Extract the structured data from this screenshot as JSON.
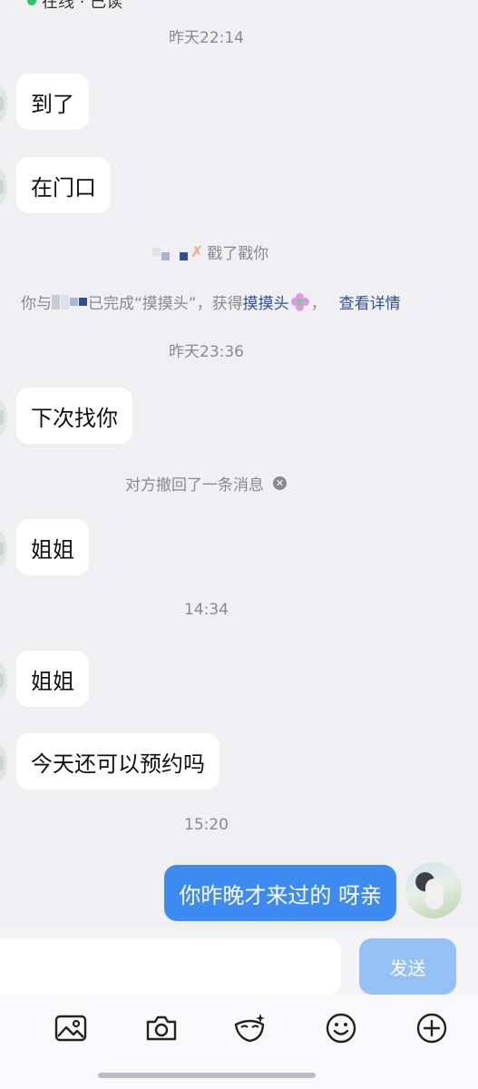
{
  "header": {
    "partial_text": "在线 · 已读"
  },
  "messages": {
    "time_1": "昨天22:14",
    "msg_1": "到了",
    "msg_2": "在门口",
    "poke_text": "戳了戳你",
    "achievement": {
      "prefix": "你与",
      "middle": "已完成“摸摸头”，获得",
      "award": "摸摸头",
      "suffix": "，",
      "link": "查看详情"
    },
    "time_2": "昨天23:36",
    "msg_3": "下次找你",
    "recall_text": "对方撤回了一条消息",
    "msg_4": "姐姐",
    "time_3": "14:34",
    "msg_5": "姐姐",
    "msg_6": "今天还可以预约吗",
    "time_4": "15:20",
    "my_msg": "你昨晚才来过的 呀亲"
  },
  "input": {
    "send_label": "发送",
    "value": ""
  },
  "toolbar": {
    "items": [
      "image-icon",
      "camera-icon",
      "sticker-icon",
      "emoji-icon",
      "plus-icon"
    ]
  },
  "colors": {
    "my_bubble": "#3d8bf2",
    "send_button": "#93c1f6",
    "link": "#2f4f9e"
  }
}
